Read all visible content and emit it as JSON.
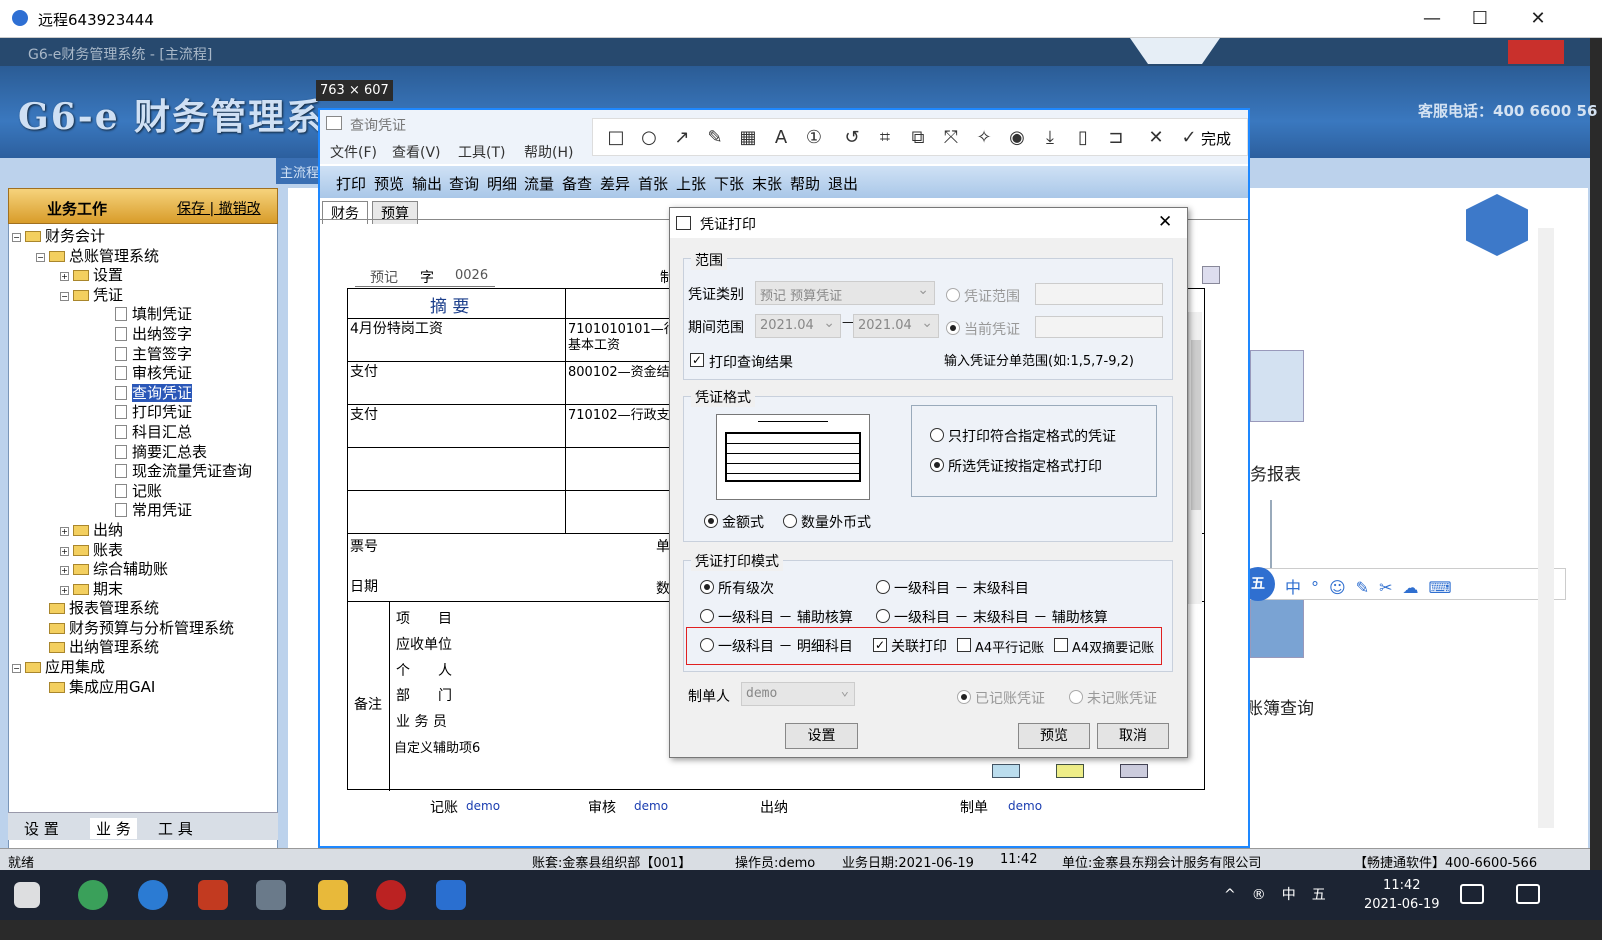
{
  "remote": {
    "title": "远程643923444",
    "min": "—",
    "max": "☐",
    "close": "✕"
  },
  "app": {
    "title": "G6-e财务管理系统 - [主流程]",
    "logo": "G6-e 财务管理系",
    "hotline": "客服电话：400 6600 56",
    "panel_title": "业务工作",
    "panel_links": "保存 | 撤销改",
    "tree": [
      {
        "label": "财务会计",
        "level": 0,
        "type": "folder",
        "pm": "−"
      },
      {
        "label": "总账管理系统",
        "level": 1,
        "type": "folder",
        "pm": "−"
      },
      {
        "label": "设置",
        "level": 2,
        "type": "folder",
        "pm": "+"
      },
      {
        "label": "凭证",
        "level": 2,
        "type": "folder",
        "pm": "−"
      },
      {
        "label": "填制凭证",
        "level": 3,
        "type": "doc"
      },
      {
        "label": "出纳签字",
        "level": 3,
        "type": "doc"
      },
      {
        "label": "主管签字",
        "level": 3,
        "type": "doc"
      },
      {
        "label": "审核凭证",
        "level": 3,
        "type": "doc"
      },
      {
        "label": "查询凭证",
        "level": 3,
        "type": "doc",
        "selected": true
      },
      {
        "label": "打印凭证",
        "level": 3,
        "type": "doc"
      },
      {
        "label": "科目汇总",
        "level": 3,
        "type": "doc"
      },
      {
        "label": "摘要汇总表",
        "level": 3,
        "type": "doc"
      },
      {
        "label": "现金流量凭证查询",
        "level": 3,
        "type": "doc"
      },
      {
        "label": "记账",
        "level": 3,
        "type": "doc"
      },
      {
        "label": "常用凭证",
        "level": 3,
        "type": "doc"
      },
      {
        "label": "出纳",
        "level": 2,
        "type": "folder",
        "pm": "+"
      },
      {
        "label": "账表",
        "level": 2,
        "type": "folder",
        "pm": "+"
      },
      {
        "label": "综合辅助账",
        "level": 2,
        "type": "folder",
        "pm": "+"
      },
      {
        "label": "期末",
        "level": 2,
        "type": "folder",
        "pm": "+"
      },
      {
        "label": "报表管理系统",
        "level": 1,
        "type": "folder"
      },
      {
        "label": "财务预算与分析管理系统",
        "level": 1,
        "type": "folder"
      },
      {
        "label": "出纳管理系统",
        "level": 1,
        "type": "folder"
      },
      {
        "label": "应用集成",
        "level": 0,
        "type": "folder",
        "pm": "−"
      },
      {
        "label": "集成应用GAI",
        "level": 1,
        "type": "folder"
      }
    ],
    "bottom_tabs": [
      "设 置",
      "业 务",
      "工 具"
    ],
    "right_labels": {
      "reports": "务报表",
      "books": "账簿查询",
      "tab": "主流程"
    },
    "status": {
      "ready": "就绪",
      "account": "账套:金寨县组织部【001】",
      "operator": "操作员:demo",
      "date": "业务日期:2021-06-19",
      "time": "11:42",
      "unit": "单位:金寨县东翔会计服务有限公司",
      "vendor": "【畅捷通软件】400-6600-566"
    },
    "taskbar_time": "11:42",
    "taskbar_date": "2021-06-19"
  },
  "capture": {
    "size": "763 × 607",
    "done": "完成"
  },
  "query": {
    "title": "查询凭证",
    "menu": [
      "文件(F)",
      "查看(V)",
      "工具(T)",
      "帮助(H)"
    ],
    "toolbar": [
      "打印",
      "预览",
      "输出",
      "查询",
      "明细",
      "流量",
      "备查",
      "差异",
      "首张",
      "上张",
      "下张",
      "末张",
      "帮助",
      "退出"
    ],
    "tabs": [
      "财务",
      "预算"
    ]
  },
  "voucher": {
    "type": "预记",
    "zi": "字",
    "no": "0026",
    "zhi": "制",
    "summary_header": "摘 要",
    "rows": [
      {
        "summary": "4月份特岗工资",
        "account": "7101010101—行政",
        "account2": "基本工资"
      },
      {
        "summary": "支付",
        "account": "800102—资金结存"
      },
      {
        "summary": "支付",
        "account": "710102—行政支出"
      }
    ],
    "ticket": "票号",
    "date": "日期",
    "dan": "单",
    "shu": "数",
    "remark": "备注",
    "items": [
      "项　　目",
      "应收单位",
      "个　　人",
      "部　　门",
      "业 务 员",
      "自定义辅助项6"
    ],
    "footer": {
      "post": "记账",
      "post_user": "demo",
      "audit": "审核",
      "audit_user": "demo",
      "cashier": "出纳",
      "maker": "制单",
      "maker_user": "demo"
    }
  },
  "dialog": {
    "title": "凭证打印",
    "close": "✕",
    "range": {
      "group": "范围",
      "type_label": "凭证类别",
      "type_value": "预记  预算凭证",
      "period_label": "期间范围",
      "period_from": "2021.04",
      "period_dash": "—",
      "period_to": "2021.04",
      "opt_range": "凭证范围",
      "opt_current": "当前凭证",
      "print_query": "打印查询结果",
      "hint": "输入凭证分单范围(如:1,5,7-9,2)"
    },
    "format": {
      "group": "凭证格式",
      "opt_only": "只打印符合指定格式的凭证",
      "opt_all": "所选凭证按指定格式打印",
      "amount": "金额式",
      "qty": "数量外币式"
    },
    "mode": {
      "group": "凭证打印模式",
      "all_levels": "所有级次",
      "first_last": "一级科目 － 末级科目",
      "first_aux": "一级科目 － 辅助核算",
      "first_last_aux": "一级科目 － 末级科目 － 辅助核算",
      "first_detail": "一级科目 － 明细科目",
      "linked": "关联打印",
      "a4_parallel": "A4平行记账",
      "a4_double": "A4双摘要记账"
    },
    "maker_label": "制单人",
    "maker_value": "demo",
    "posted": "已记账凭证",
    "unposted": "未记账凭证",
    "btn_settings": "设置",
    "btn_preview": "预览",
    "btn_cancel": "取消"
  },
  "colors": {
    "accent": "#1e88ff",
    "highlight": "#e02020",
    "banner": "#3a78bf"
  }
}
